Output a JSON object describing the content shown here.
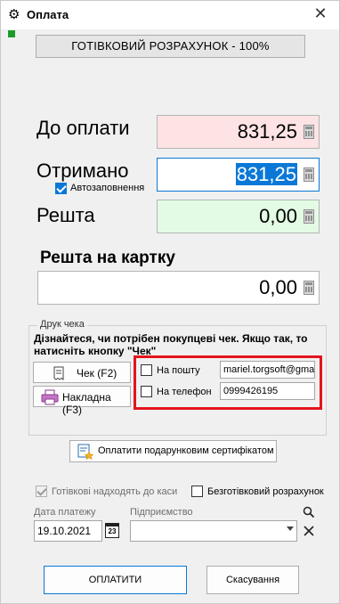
{
  "window": {
    "title": "Оплата",
    "icon": "gear-icon",
    "close_glyph": "✕"
  },
  "payment_type": "ГОТІВКОВИЙ РОЗРАХУНОК - 100%",
  "amounts": {
    "due_label": "До оплати",
    "due_value": "831,25",
    "received_label": "Отримано",
    "received_value": "831,25",
    "autofill_label": "Автозаповнення",
    "autofill_checked": true,
    "change_label": "Решта",
    "change_value": "0,00",
    "change_to_card_label": "Решта на картку",
    "change_to_card_value": "0,00"
  },
  "receipt": {
    "group_title": "Друк чека",
    "hint": "Дізнайтеся, чи потрібен покупцеві чек. Якщо так, то натисніть кнопку \"Чек\"",
    "check_button": "Чек (F2)",
    "invoice_button": "Накладна (F3)",
    "email_label": "На пошту",
    "email_value": "mariel.torgsoft@gma",
    "phone_label": "На телефон",
    "phone_value": "0999426195"
  },
  "gift_certificate_button": "Оплатити подарунковим сертифікатом",
  "options": {
    "cash_to_register_label": "Готівкові надходять до каси",
    "cash_to_register_checked": true,
    "non_cash_label": "Безготівковий розрахунок",
    "non_cash_checked": false
  },
  "payment_date": {
    "label": "Дата платежу",
    "value": "19.10.2021",
    "calendar_day": "23"
  },
  "enterprise": {
    "label": "Підприємство",
    "value": ""
  },
  "actions": {
    "pay": "ОПЛАТИТИ",
    "cancel": "Скасування"
  },
  "colors": {
    "accent": "#0a78d7",
    "highlight": "#e3141e",
    "due_bg": "#fde3e3",
    "change_bg": "#e3fbe4"
  }
}
